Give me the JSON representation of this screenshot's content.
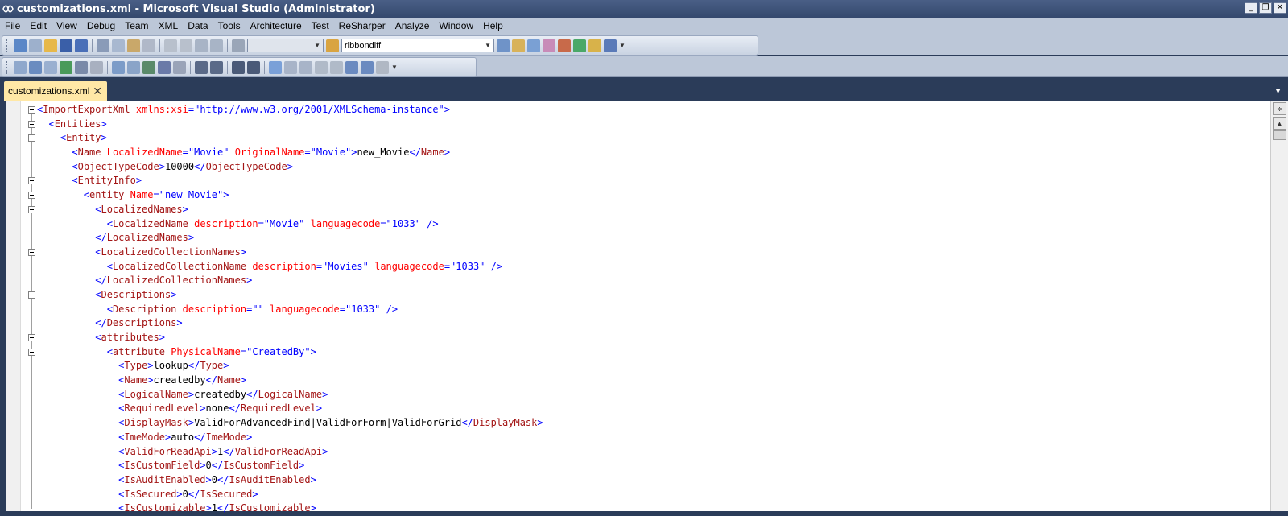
{
  "window": {
    "title": "customizations.xml - Microsoft Visual Studio (Administrator)",
    "min_glyph": "_",
    "max_glyph": "❐",
    "close_glyph": "✕"
  },
  "menu": [
    "File",
    "Edit",
    "View",
    "Debug",
    "Team",
    "XML",
    "Data",
    "Tools",
    "Architecture",
    "Test",
    "ReSharper",
    "Analyze",
    "Window",
    "Help"
  ],
  "toolbar": {
    "config_combo": "",
    "find_combo": "ribbondiff"
  },
  "tabs": [
    {
      "label": "customizations.xml",
      "active": true
    }
  ],
  "editor": {
    "lines": [
      [
        [
          "d",
          "<"
        ],
        [
          "t",
          "ImportExportXml"
        ],
        [
          "c",
          " "
        ],
        [
          "a",
          "xmlns:xsi"
        ],
        [
          "d",
          "=\""
        ],
        [
          "link",
          "http://www.w3.org/2001/XMLSchema-instance"
        ],
        [
          "d",
          "\">"
        ]
      ],
      [
        [
          "c",
          "  "
        ],
        [
          "d",
          "<"
        ],
        [
          "t",
          "Entities"
        ],
        [
          "d",
          ">"
        ]
      ],
      [
        [
          "c",
          "    "
        ],
        [
          "d",
          "<"
        ],
        [
          "t",
          "Entity"
        ],
        [
          "d",
          ">"
        ]
      ],
      [
        [
          "c",
          "      "
        ],
        [
          "d",
          "<"
        ],
        [
          "t",
          "Name"
        ],
        [
          "c",
          " "
        ],
        [
          "a",
          "LocalizedName"
        ],
        [
          "d",
          "=\""
        ],
        [
          "v",
          "Movie"
        ],
        [
          "d",
          "\""
        ],
        [
          "c",
          " "
        ],
        [
          "a",
          "OriginalName"
        ],
        [
          "d",
          "=\""
        ],
        [
          "v",
          "Movie"
        ],
        [
          "d",
          "\">"
        ],
        [
          "c",
          "new_Movie"
        ],
        [
          "d",
          "</"
        ],
        [
          "t",
          "Name"
        ],
        [
          "d",
          ">"
        ]
      ],
      [
        [
          "c",
          "      "
        ],
        [
          "d",
          "<"
        ],
        [
          "t",
          "ObjectTypeCode"
        ],
        [
          "d",
          ">"
        ],
        [
          "c",
          "10000"
        ],
        [
          "d",
          "</"
        ],
        [
          "t",
          "ObjectTypeCode"
        ],
        [
          "d",
          ">"
        ]
      ],
      [
        [
          "c",
          "      "
        ],
        [
          "d",
          "<"
        ],
        [
          "t",
          "EntityInfo"
        ],
        [
          "d",
          ">"
        ]
      ],
      [
        [
          "c",
          "        "
        ],
        [
          "d",
          "<"
        ],
        [
          "t",
          "entity"
        ],
        [
          "c",
          " "
        ],
        [
          "a",
          "Name"
        ],
        [
          "d",
          "=\""
        ],
        [
          "v",
          "new_Movie"
        ],
        [
          "d",
          "\">"
        ]
      ],
      [
        [
          "c",
          "          "
        ],
        [
          "d",
          "<"
        ],
        [
          "t",
          "LocalizedNames"
        ],
        [
          "d",
          ">"
        ]
      ],
      [
        [
          "c",
          "            "
        ],
        [
          "d",
          "<"
        ],
        [
          "t",
          "LocalizedName"
        ],
        [
          "c",
          " "
        ],
        [
          "a",
          "description"
        ],
        [
          "d",
          "=\""
        ],
        [
          "v",
          "Movie"
        ],
        [
          "d",
          "\""
        ],
        [
          "c",
          " "
        ],
        [
          "a",
          "languagecode"
        ],
        [
          "d",
          "=\""
        ],
        [
          "v",
          "1033"
        ],
        [
          "d",
          "\""
        ],
        [
          "c",
          " "
        ],
        [
          "d",
          "/>"
        ]
      ],
      [
        [
          "c",
          "          "
        ],
        [
          "d",
          "</"
        ],
        [
          "t",
          "LocalizedNames"
        ],
        [
          "d",
          ">"
        ]
      ],
      [
        [
          "c",
          "          "
        ],
        [
          "d",
          "<"
        ],
        [
          "t",
          "LocalizedCollectionNames"
        ],
        [
          "d",
          ">"
        ]
      ],
      [
        [
          "c",
          "            "
        ],
        [
          "d",
          "<"
        ],
        [
          "t",
          "LocalizedCollectionName"
        ],
        [
          "c",
          " "
        ],
        [
          "a",
          "description"
        ],
        [
          "d",
          "=\""
        ],
        [
          "v",
          "Movies"
        ],
        [
          "d",
          "\""
        ],
        [
          "c",
          " "
        ],
        [
          "a",
          "languagecode"
        ],
        [
          "d",
          "=\""
        ],
        [
          "v",
          "1033"
        ],
        [
          "d",
          "\""
        ],
        [
          "c",
          " "
        ],
        [
          "d",
          "/>"
        ]
      ],
      [
        [
          "c",
          "          "
        ],
        [
          "d",
          "</"
        ],
        [
          "t",
          "LocalizedCollectionNames"
        ],
        [
          "d",
          ">"
        ]
      ],
      [
        [
          "c",
          "          "
        ],
        [
          "d",
          "<"
        ],
        [
          "t",
          "Descriptions"
        ],
        [
          "d",
          ">"
        ]
      ],
      [
        [
          "c",
          "            "
        ],
        [
          "d",
          "<"
        ],
        [
          "t",
          "Description"
        ],
        [
          "c",
          " "
        ],
        [
          "a",
          "description"
        ],
        [
          "d",
          "=\"\""
        ],
        [
          "c",
          " "
        ],
        [
          "a",
          "languagecode"
        ],
        [
          "d",
          "=\""
        ],
        [
          "v",
          "1033"
        ],
        [
          "d",
          "\""
        ],
        [
          "c",
          " "
        ],
        [
          "d",
          "/>"
        ]
      ],
      [
        [
          "c",
          "          "
        ],
        [
          "d",
          "</"
        ],
        [
          "t",
          "Descriptions"
        ],
        [
          "d",
          ">"
        ]
      ],
      [
        [
          "c",
          "          "
        ],
        [
          "d",
          "<"
        ],
        [
          "t",
          "attributes"
        ],
        [
          "d",
          ">"
        ]
      ],
      [
        [
          "c",
          "            "
        ],
        [
          "d",
          "<"
        ],
        [
          "t",
          "attribute"
        ],
        [
          "c",
          " "
        ],
        [
          "a",
          "PhysicalName"
        ],
        [
          "d",
          "=\""
        ],
        [
          "v",
          "CreatedBy"
        ],
        [
          "d",
          "\">"
        ]
      ],
      [
        [
          "c",
          "              "
        ],
        [
          "d",
          "<"
        ],
        [
          "t",
          "Type"
        ],
        [
          "d",
          ">"
        ],
        [
          "c",
          "lookup"
        ],
        [
          "d",
          "</"
        ],
        [
          "t",
          "Type"
        ],
        [
          "d",
          ">"
        ]
      ],
      [
        [
          "c",
          "              "
        ],
        [
          "d",
          "<"
        ],
        [
          "t",
          "Name"
        ],
        [
          "d",
          ">"
        ],
        [
          "c",
          "createdby"
        ],
        [
          "d",
          "</"
        ],
        [
          "t",
          "Name"
        ],
        [
          "d",
          ">"
        ]
      ],
      [
        [
          "c",
          "              "
        ],
        [
          "d",
          "<"
        ],
        [
          "t",
          "LogicalName"
        ],
        [
          "d",
          ">"
        ],
        [
          "c",
          "createdby"
        ],
        [
          "d",
          "</"
        ],
        [
          "t",
          "LogicalName"
        ],
        [
          "d",
          ">"
        ]
      ],
      [
        [
          "c",
          "              "
        ],
        [
          "d",
          "<"
        ],
        [
          "t",
          "RequiredLevel"
        ],
        [
          "d",
          ">"
        ],
        [
          "c",
          "none"
        ],
        [
          "d",
          "</"
        ],
        [
          "t",
          "RequiredLevel"
        ],
        [
          "d",
          ">"
        ]
      ],
      [
        [
          "c",
          "              "
        ],
        [
          "d",
          "<"
        ],
        [
          "t",
          "DisplayMask"
        ],
        [
          "d",
          ">"
        ],
        [
          "c",
          "ValidForAdvancedFind|ValidForForm|ValidForGrid"
        ],
        [
          "d",
          "</"
        ],
        [
          "t",
          "DisplayMask"
        ],
        [
          "d",
          ">"
        ]
      ],
      [
        [
          "c",
          "              "
        ],
        [
          "d",
          "<"
        ],
        [
          "t",
          "ImeMode"
        ],
        [
          "d",
          ">"
        ],
        [
          "c",
          "auto"
        ],
        [
          "d",
          "</"
        ],
        [
          "t",
          "ImeMode"
        ],
        [
          "d",
          ">"
        ]
      ],
      [
        [
          "c",
          "              "
        ],
        [
          "d",
          "<"
        ],
        [
          "t",
          "ValidForReadApi"
        ],
        [
          "d",
          ">"
        ],
        [
          "c",
          "1"
        ],
        [
          "d",
          "</"
        ],
        [
          "t",
          "ValidForReadApi"
        ],
        [
          "d",
          ">"
        ]
      ],
      [
        [
          "c",
          "              "
        ],
        [
          "d",
          "<"
        ],
        [
          "t",
          "IsCustomField"
        ],
        [
          "d",
          ">"
        ],
        [
          "c",
          "0"
        ],
        [
          "d",
          "</"
        ],
        [
          "t",
          "IsCustomField"
        ],
        [
          "d",
          ">"
        ]
      ],
      [
        [
          "c",
          "              "
        ],
        [
          "d",
          "<"
        ],
        [
          "t",
          "IsAuditEnabled"
        ],
        [
          "d",
          ">"
        ],
        [
          "c",
          "0"
        ],
        [
          "d",
          "</"
        ],
        [
          "t",
          "IsAuditEnabled"
        ],
        [
          "d",
          ">"
        ]
      ],
      [
        [
          "c",
          "              "
        ],
        [
          "d",
          "<"
        ],
        [
          "t",
          "IsSecured"
        ],
        [
          "d",
          ">"
        ],
        [
          "c",
          "0"
        ],
        [
          "d",
          "</"
        ],
        [
          "t",
          "IsSecured"
        ],
        [
          "d",
          ">"
        ]
      ],
      [
        [
          "c",
          "              "
        ],
        [
          "d",
          "<"
        ],
        [
          "t",
          "IsCustomizable"
        ],
        [
          "d",
          ">"
        ],
        [
          "c",
          "1"
        ],
        [
          "d",
          "</"
        ],
        [
          "t",
          "IsCustomizable"
        ],
        [
          "d",
          ">"
        ]
      ]
    ],
    "fold_lines": [
      0,
      1,
      2,
      5,
      6,
      7,
      10,
      13,
      16,
      17
    ]
  },
  "colors": {
    "delimiter": "#0000ff",
    "tag": "#a31515",
    "attribute": "#ff0000",
    "value": "#0000ff",
    "text": "#000000",
    "tab_active": "#ffe8a6",
    "chrome": "#2b3c59"
  }
}
